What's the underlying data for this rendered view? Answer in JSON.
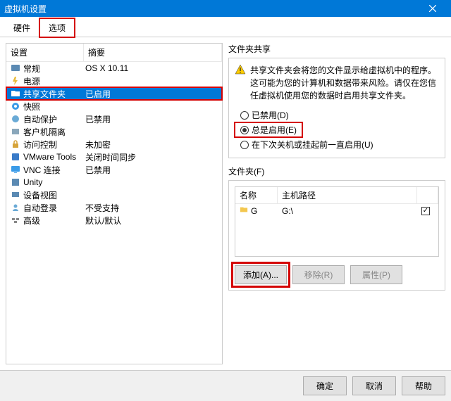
{
  "window": {
    "title": "虚拟机设置"
  },
  "tabs": {
    "hardware": "硬件",
    "options": "选项"
  },
  "list": {
    "header": {
      "setting": "设置",
      "summary": "摘要"
    },
    "rows": [
      {
        "label": "常规",
        "summary": "OS X 10.11"
      },
      {
        "label": "电源",
        "summary": ""
      },
      {
        "label": "共享文件夹",
        "summary": "已启用"
      },
      {
        "label": "快照",
        "summary": ""
      },
      {
        "label": "自动保护",
        "summary": "已禁用"
      },
      {
        "label": "客户机隔离",
        "summary": ""
      },
      {
        "label": "访问控制",
        "summary": "未加密"
      },
      {
        "label": "VMware Tools",
        "summary": "关闭时间同步"
      },
      {
        "label": "VNC 连接",
        "summary": "已禁用"
      },
      {
        "label": "Unity",
        "summary": ""
      },
      {
        "label": "设备视图",
        "summary": ""
      },
      {
        "label": "自动登录",
        "summary": "不受支持"
      },
      {
        "label": "高级",
        "summary": "默认/默认"
      }
    ]
  },
  "sharing": {
    "group_label": "文件夹共享",
    "warning": "共享文件夹会将您的文件显示给虚拟机中的程序。这可能为您的计算机和数据带来风险。请仅在您信任虚拟机使用您的数据时启用共享文件夹。",
    "radio_disabled": "已禁用(D)",
    "radio_always": "总是启用(E)",
    "radio_until": "在下次关机或挂起前一直启用(U)"
  },
  "folders": {
    "group_label": "文件夹(F)",
    "header_name": "名称",
    "header_path": "主机路径",
    "rows": [
      {
        "name": "G",
        "path": "G:\\",
        "checked": true
      }
    ],
    "add": "添加(A)...",
    "remove": "移除(R)",
    "props": "属性(P)"
  },
  "footer": {
    "ok": "确定",
    "cancel": "取消",
    "help": "帮助"
  }
}
